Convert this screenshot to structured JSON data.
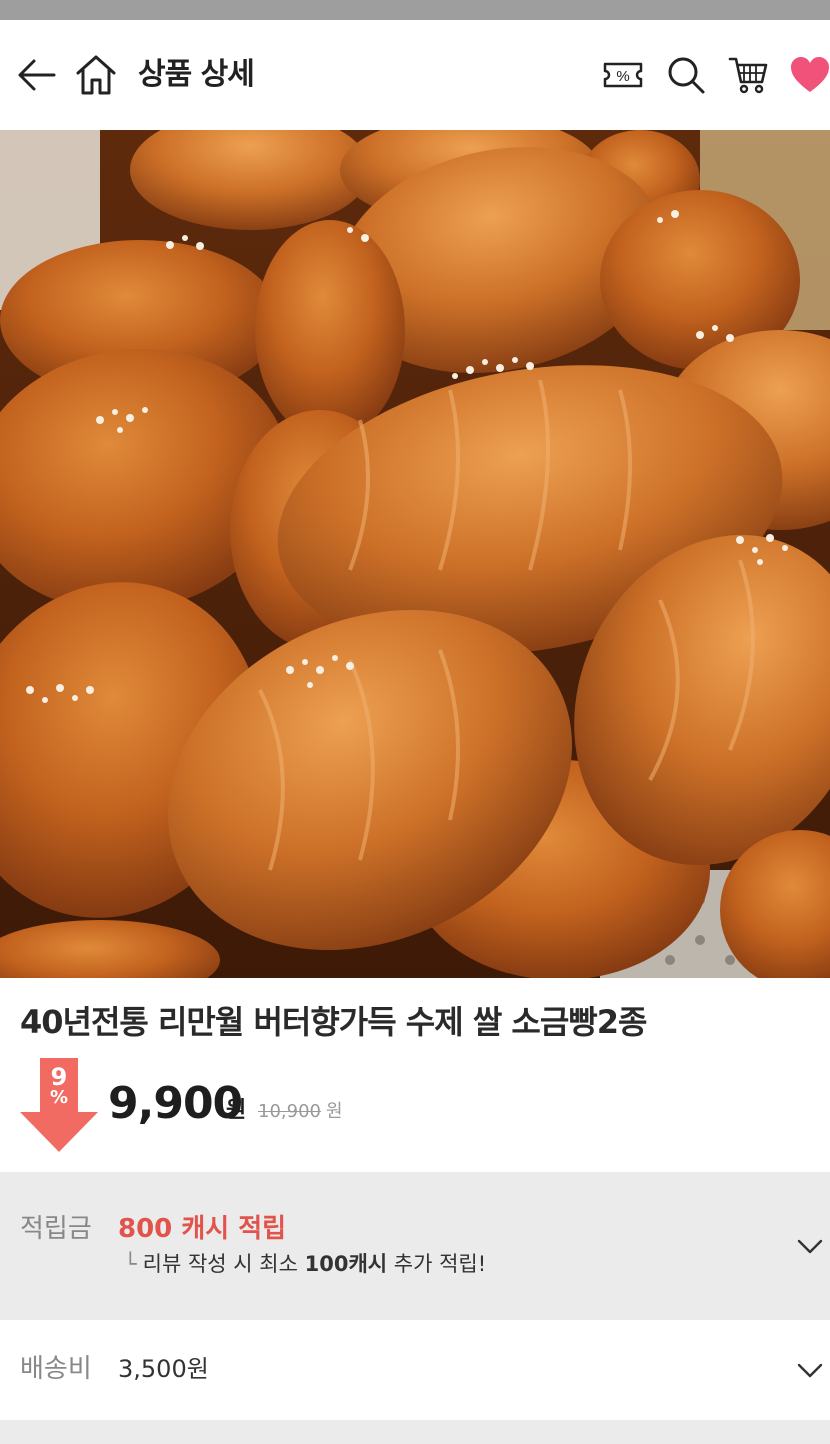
{
  "header": {
    "title": "상품 상세",
    "icons": {
      "back": "back-arrow-icon",
      "home": "home-icon",
      "coupon": "coupon-icon",
      "search": "search-icon",
      "cart": "cart-icon",
      "wishlist": "heart-icon"
    },
    "coupon_symbol": "%",
    "accent_color": "#f0527a"
  },
  "product": {
    "title": "40년전통 리만월 버터향가득 수제 쌀 소금빵2종",
    "discount": "9",
    "discount_unit": "%",
    "price": "9,900",
    "price_unit": "원",
    "original_price": "10,900",
    "original_unit": "원",
    "discount_color": "#f26b63"
  },
  "points": {
    "label": "적립금",
    "value": "800 캐시 적립",
    "sub_prefix": "리뷰 작성 시 최소 ",
    "sub_bold": "100캐시",
    "sub_suffix": " 추가 적립!",
    "value_color": "#e2534b"
  },
  "shipping": {
    "label": "배송비",
    "value": "3,500원"
  }
}
